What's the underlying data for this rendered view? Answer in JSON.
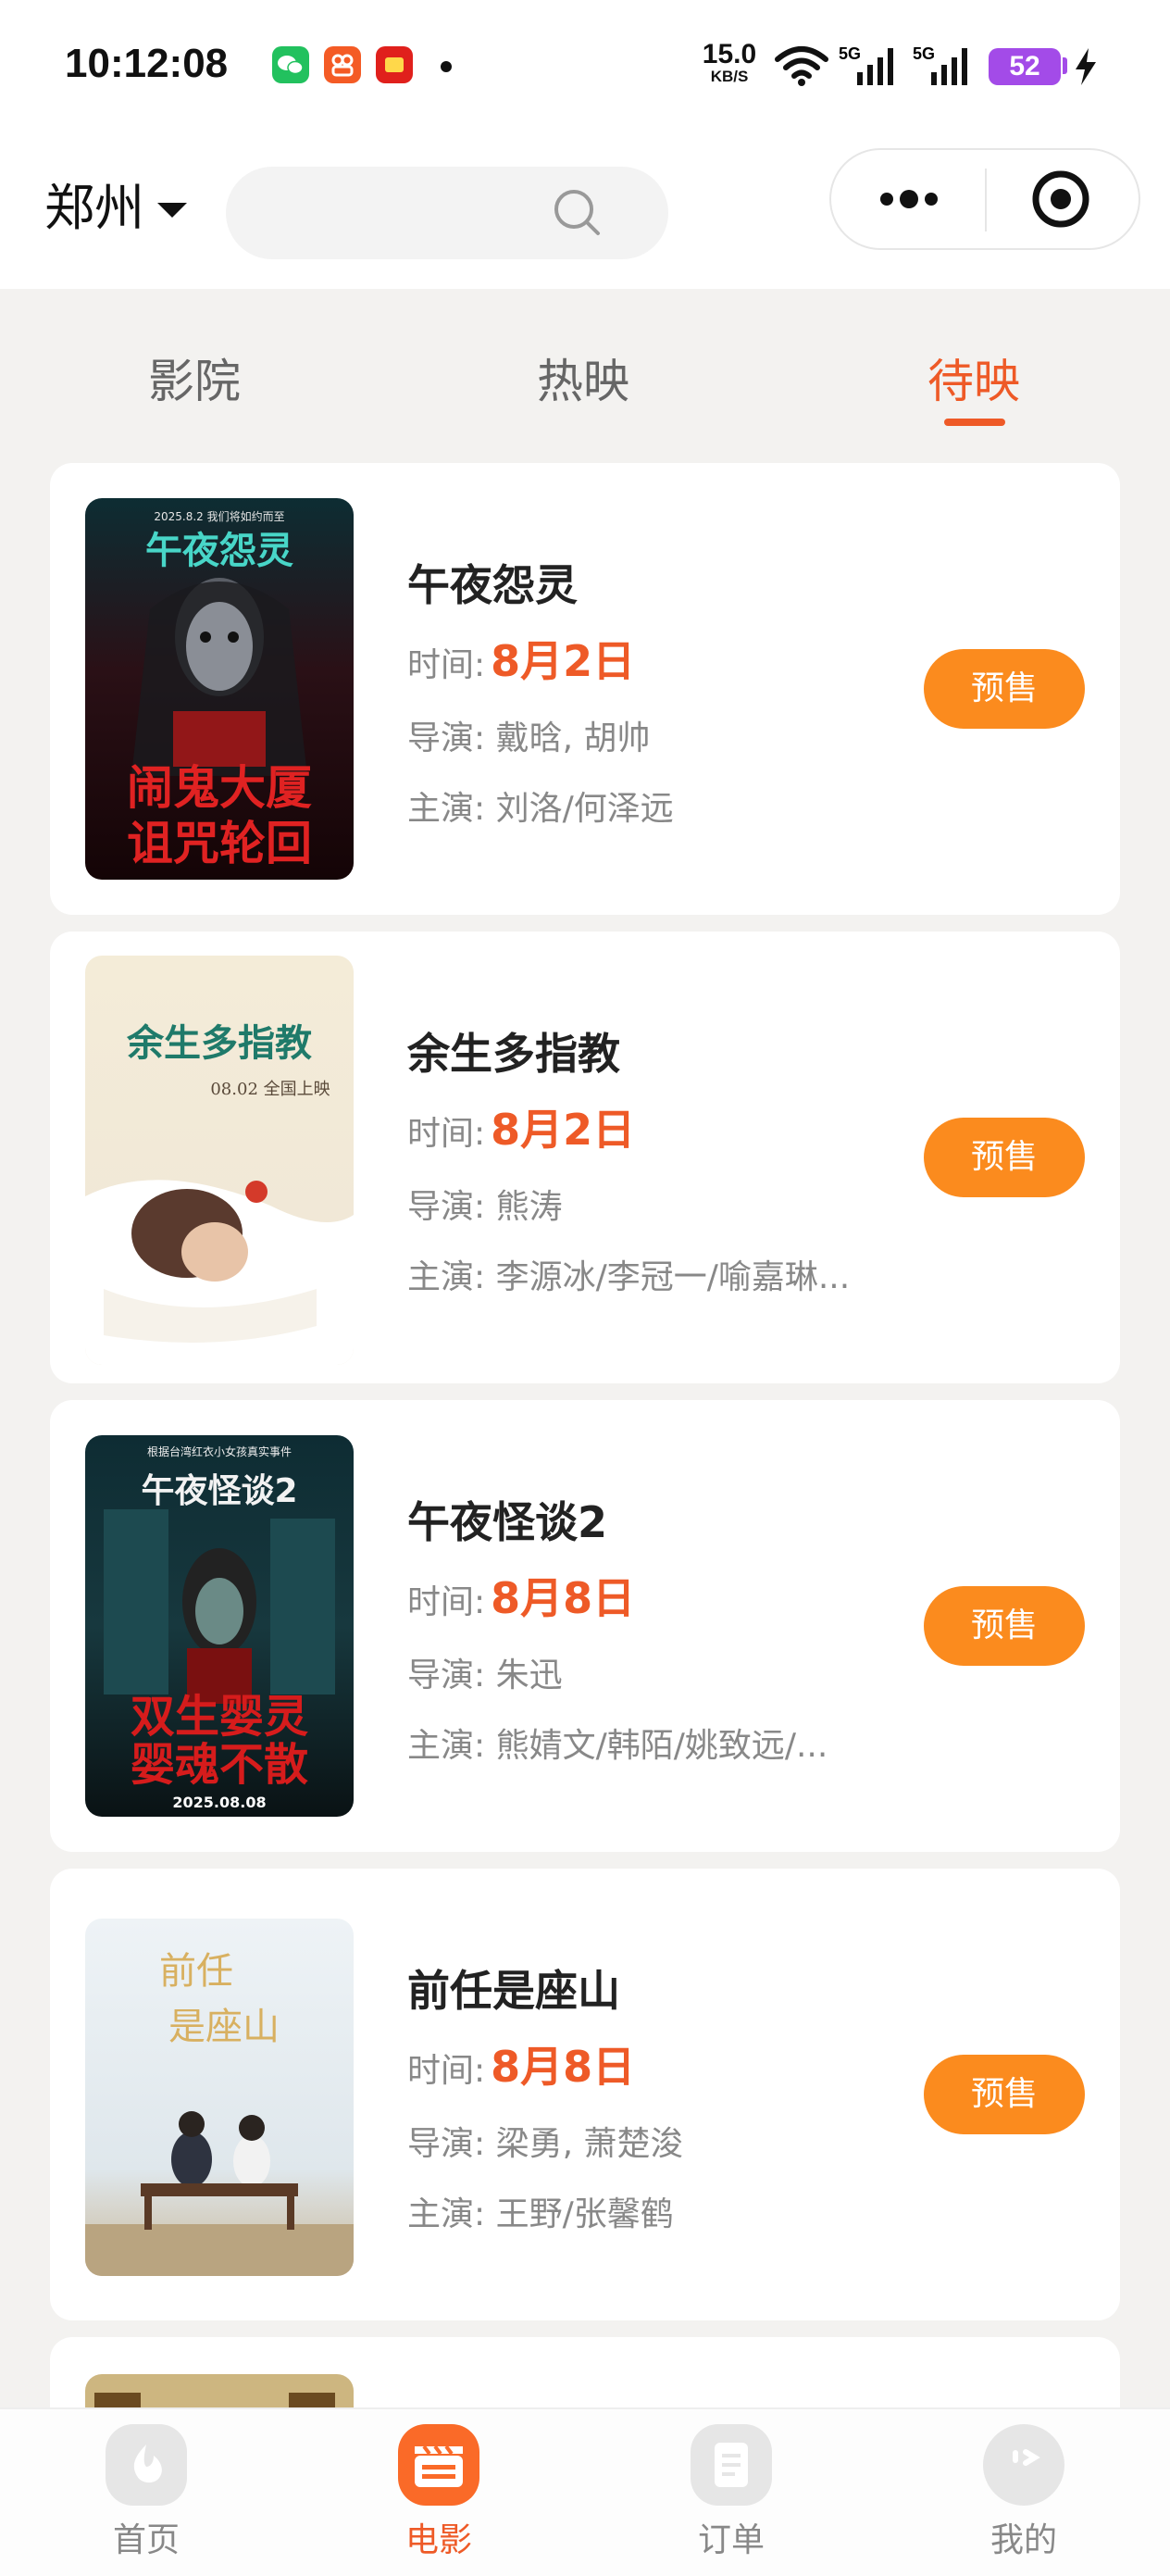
{
  "status_bar": {
    "time": "10:12:08",
    "net_speed_value": "15.0",
    "net_speed_unit": "KB/S",
    "signal_1": "5G",
    "signal_2": "5G",
    "battery": "52"
  },
  "header": {
    "city": "郑州",
    "search_placeholder": ""
  },
  "tabs": [
    {
      "label": "影院",
      "active": false
    },
    {
      "label": "热映",
      "active": false
    },
    {
      "label": "待映",
      "active": true
    }
  ],
  "labels": {
    "time": "时间:",
    "director": "导演:",
    "cast": "主演:",
    "presale": "预售"
  },
  "movies": [
    {
      "title": "午夜怨灵",
      "date": "8月2日",
      "director": "戴晗, 胡帅",
      "cast": "刘洛/何泽远",
      "poster_lines": [
        "2025.8.2 我们将如约而至",
        "午夜怨灵",
        "闹鬼大厦",
        "诅咒轮回"
      ]
    },
    {
      "title": "余生多指教",
      "date": "8月2日",
      "director": "熊涛",
      "cast": "李源冰/李冠一/喻嘉琳...",
      "poster_lines": [
        "余生多指教",
        "08.02 全国上映"
      ]
    },
    {
      "title": "午夜怪谈2",
      "date": "8月8日",
      "director": "朱迅",
      "cast": "熊婧文/韩陌/姚致远/...",
      "poster_lines": [
        "根据台湾红衣小女孩真实事件",
        "午夜怪谈2",
        "双生婴灵",
        "婴魂不散",
        "2025.08.08"
      ]
    },
    {
      "title": "前任是座山",
      "date": "8月8日",
      "director": "梁勇, 萧楚浚",
      "cast": "王野/张馨鹤",
      "poster_lines": [
        "前任",
        "是座山"
      ]
    }
  ],
  "tab_bar": [
    {
      "label": "首页",
      "active": false,
      "icon": "home-icon"
    },
    {
      "label": "电影",
      "active": true,
      "icon": "clapperboard-icon"
    },
    {
      "label": "订单",
      "active": false,
      "icon": "order-receipt-icon"
    },
    {
      "label": "我的",
      "active": false,
      "icon": "profile-icon"
    }
  ],
  "colors": {
    "accent": "#ee5a27",
    "presale_button": "#fb8b1e",
    "page_bg": "#f3f2f0"
  }
}
